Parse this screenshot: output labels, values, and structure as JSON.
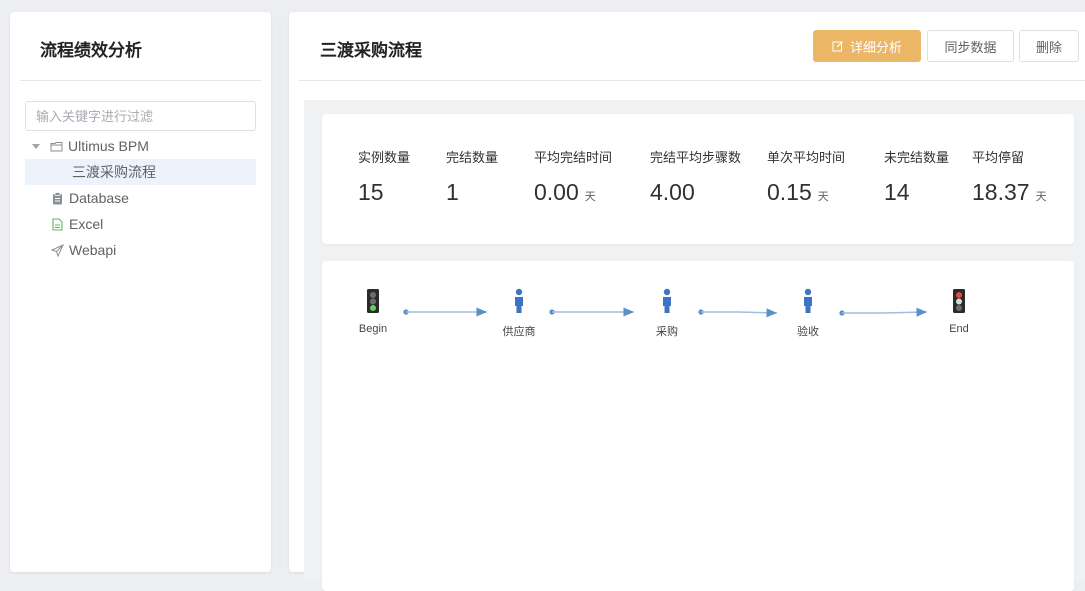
{
  "sidebar": {
    "title": "流程绩效分析",
    "filter_placeholder": "输入关键字进行过滤",
    "tree": [
      {
        "label": "Ultimus BPM",
        "icon": "folder-icon"
      },
      {
        "label": "三渡采购流程",
        "icon": "",
        "selected": true
      },
      {
        "label": "Database",
        "icon": "clipboard-icon"
      },
      {
        "label": "Excel",
        "icon": "document-icon"
      },
      {
        "label": "Webapi",
        "icon": "send-icon"
      }
    ]
  },
  "main": {
    "title": "三渡采购流程",
    "buttons": {
      "detail": "详细分析",
      "sync": "同步数据",
      "delete": "删除"
    },
    "stats": [
      {
        "label": "实例数量",
        "value": "15",
        "unit": ""
      },
      {
        "label": "完结数量",
        "value": "1",
        "unit": ""
      },
      {
        "label": "平均完结时间",
        "value": "0.00",
        "unit": "天"
      },
      {
        "label": "完结平均步骤数",
        "value": "4.00",
        "unit": ""
      },
      {
        "label": "单次平均时间",
        "value": "0.15",
        "unit": "天"
      },
      {
        "label": "未完结数量",
        "value": "14",
        "unit": ""
      },
      {
        "label": "平均停留",
        "value": "18.37",
        "unit": "天"
      }
    ],
    "flow": {
      "nodes": [
        {
          "label": "Begin",
          "icon": "traffic-light-green-icon"
        },
        {
          "label": "供应商",
          "icon": "person-icon"
        },
        {
          "label": "采购",
          "icon": "person-icon"
        },
        {
          "label": "验收",
          "icon": "person-icon"
        },
        {
          "label": "End",
          "icon": "traffic-light-red-icon"
        }
      ]
    }
  },
  "colors": {
    "accent": "#ebb767",
    "selected_bg": "#ecf3fd",
    "flow_line": "#5b8fc7",
    "person": "#3a74c2"
  }
}
